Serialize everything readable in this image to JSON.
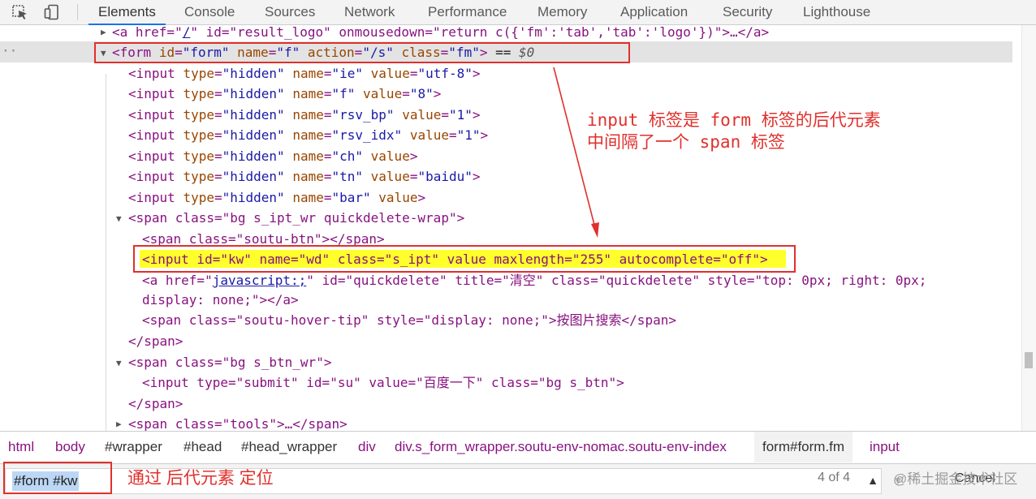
{
  "toolbar": {
    "tabs": [
      "Elements",
      "Console",
      "Sources",
      "Network",
      "Performance",
      "Memory",
      "Application",
      "Security",
      "Lighthouse"
    ]
  },
  "dom": {
    "lines": {
      "l0": {
        "pre": "<a href=\"",
        "link": "/",
        "mid": "\" id=\"result_logo\" onmousedown=\"return c({'fm':'tab','tab':'logo'})\">…</a>"
      },
      "form": {
        "tag1": "<form",
        "attrs": [
          [
            "id",
            "\"form\""
          ],
          [
            "name",
            "\"f\""
          ],
          [
            "action",
            "\"/s\""
          ],
          [
            "class",
            "\"fm\""
          ]
        ],
        "close": ">",
        "eq": "== ",
        "dollar": "$0"
      },
      "hidden": [
        [
          [
            "type",
            "\"hidden\""
          ],
          [
            "name",
            "\"ie\""
          ],
          [
            "value",
            "\"utf-8\""
          ]
        ],
        [
          [
            "type",
            "\"hidden\""
          ],
          [
            "name",
            "\"f\""
          ],
          [
            "value",
            "\"8\""
          ]
        ],
        [
          [
            "type",
            "\"hidden\""
          ],
          [
            "name",
            "\"rsv_bp\""
          ],
          [
            "value",
            "\"1\""
          ]
        ],
        [
          [
            "type",
            "\"hidden\""
          ],
          [
            "name",
            "\"rsv_idx\""
          ],
          [
            "value",
            "\"1\""
          ]
        ],
        [
          [
            "type",
            "\"hidden\""
          ],
          [
            "name",
            "\"ch\""
          ],
          [
            "value",
            ""
          ]
        ],
        [
          [
            "type",
            "\"hidden\""
          ],
          [
            "name",
            "\"tn\""
          ],
          [
            "value",
            "\"baidu\""
          ]
        ],
        [
          [
            "type",
            "\"hidden\""
          ],
          [
            "name",
            "\"bar\""
          ],
          [
            "value",
            ""
          ]
        ]
      ],
      "span1": "<span class=\"bg s_ipt_wr quickdelete-wrap\">",
      "soutu_btn": "<span class=\"soutu-btn\"></span>",
      "kw": "<input id=\"kw\" name=\"wd\" class=\"s_ipt\" value maxlength=\"255\" autocomplete=\"off\">",
      "quick_a1": "\" id=\"quickdelete\" title=\"清空\" class=\"quickdelete\" style=\"top: 0px; right: 0px;",
      "quick_pre": "<a href=\"",
      "quick_link": "javascript:;",
      "quick_a2": "display: none;\"></a>",
      "hover_tip": "<span class=\"soutu-hover-tip\" style=\"display: none;\">按图片搜索</span>",
      "span_close1": "</span>",
      "span2": "<span class=\"bg s_btn_wr\">",
      "submit": "<input type=\"submit\" id=\"su\" value=\"百度一下\" class=\"bg s_btn\">",
      "span_close2": "</span>",
      "tools": "<span class=\"tools\">…</span>"
    }
  },
  "annotations": {
    "note1": "input 标签是 form 标签的后代元素",
    "note2": "中间隔了一个 span 标签",
    "search_note": "通过 后代元素 定位"
  },
  "breadcrumbs": [
    "html",
    "body",
    "#wrapper",
    "#head",
    "#head_wrapper",
    "div",
    "div.s_form_wrapper.soutu-env-nomac.soutu-env-index",
    "form#form.fm",
    "input"
  ],
  "search": {
    "value": "#form #kw",
    "count": "4 of 4",
    "cancel": "Cancel",
    "watermark": "@稀土掘金技术社区"
  },
  "colors": {
    "annotation": "#e0302c",
    "highlight": "#ffff2b",
    "tag": "#881280",
    "attr_name": "#994500",
    "attr_value": "#1a1aa6"
  }
}
